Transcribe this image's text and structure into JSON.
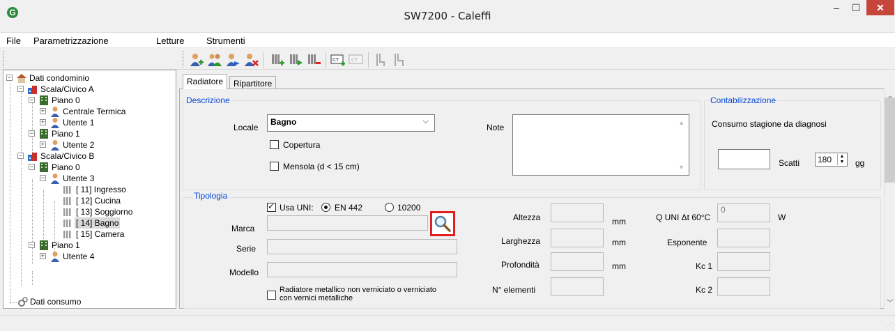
{
  "window": {
    "title": "SW7200 - Caleffi",
    "icon": "G",
    "min": "–",
    "max": "☐",
    "close": "✕"
  },
  "menu": [
    "File",
    "Parametrizzazione",
    "Letture",
    "Strumenti"
  ],
  "toolbar": {
    "icons": [
      "add-user-icon",
      "users-icon",
      "move-user-icon",
      "delete-user-icon",
      "add-radiator-icon",
      "play-radiator-icon",
      "remove-radiator-icon",
      "add-ct-icon",
      "ct-icon",
      "add-pipe-icon",
      "pipe-icon"
    ]
  },
  "tree": {
    "root": "Dati condominio",
    "scala_a": "Scala/Civico A",
    "piano_0a": "Piano  0",
    "centrale": "Centrale Termica",
    "utente1": "Utente 1",
    "piano_1a": "Piano  1",
    "utente2": "Utente 2",
    "scala_b": "Scala/Civico B",
    "piano_0b": "Piano  0",
    "utente3": "Utente 3",
    "r11": "[ 11] Ingresso",
    "r12": "[ 12] Cucina",
    "r13": "[ 13] Soggiorno",
    "r14": "[ 14] Bagno",
    "r15": "[ 15] Camera",
    "piano_1b": "Piano  1",
    "utente4": "Utente 4",
    "consumo": "Dati consumo"
  },
  "tabs": {
    "radiatore": "Radiatore",
    "ripartitore": "Ripartitore"
  },
  "descrizione": {
    "title": "Descrizione",
    "locale_label": "Locale",
    "locale_value": "Bagno",
    "copertura": "Copertura",
    "mensola": "Mensola (d < 15 cm)",
    "note_label": "Note",
    "note_value": ""
  },
  "contabilizzazione": {
    "title": "Contabilizzazione",
    "consumo_label": "Consumo stagione da diagnosi",
    "consumo_value": "",
    "scatti_label": "Scatti",
    "scatti_value": "180",
    "gg_label": "gg"
  },
  "tipologia": {
    "title": "Tipologia",
    "usa_uni": "Usa UNI:",
    "en442": "EN 442",
    "r10200": "10200",
    "marca_label": "Marca",
    "marca_value": "",
    "serie_label": "Serie",
    "serie_value": "",
    "modello_label": "Modello",
    "modello_value": "",
    "metallico_1": "Radiatore metallico non verniciato o verniciato",
    "metallico_2": "con vernici metalliche",
    "altezza": "Altezza",
    "larghezza": "Larghezza",
    "profondita": "Profondità",
    "n_elementi": "N° elementi",
    "mm": "mm",
    "quni_label": "Q UNI Δt 60°C",
    "quni_value": "0",
    "w": "W",
    "esponente": "Esponente",
    "kc1": "Kc 1",
    "kc2": "Kc 2"
  }
}
